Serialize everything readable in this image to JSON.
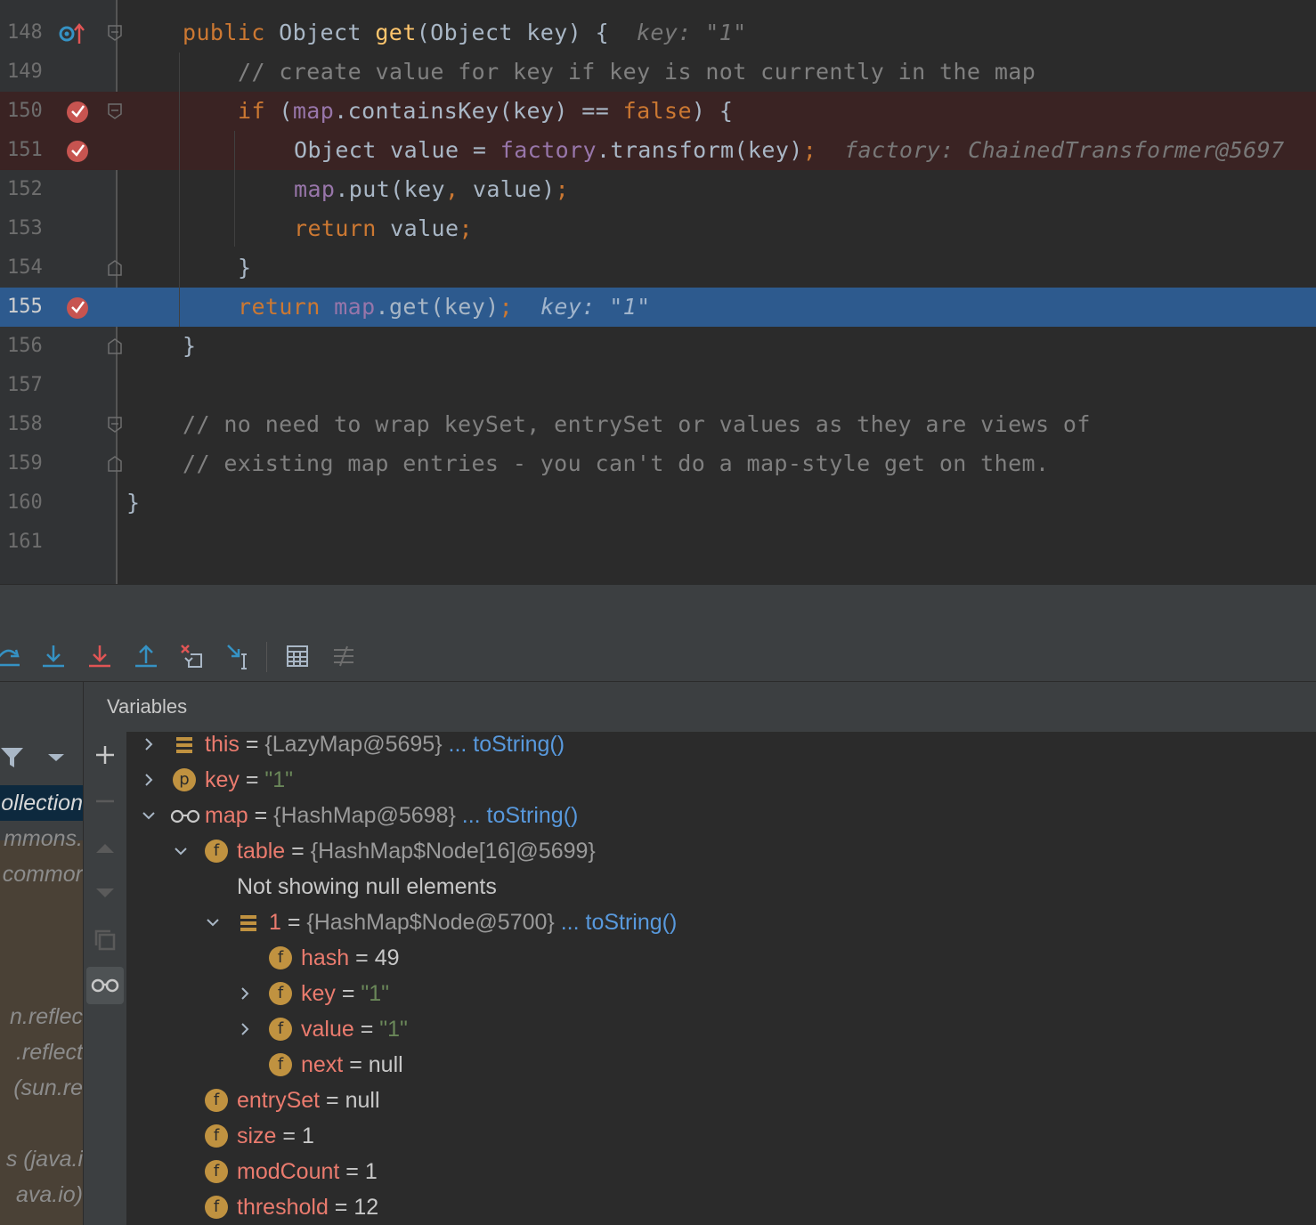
{
  "editor": {
    "lines": [
      {
        "num": "148",
        "t": [
          [
            "kw",
            "public "
          ],
          [
            "",
            "Object "
          ],
          [
            "fn",
            "get"
          ],
          [
            "",
            "(Object key) {  "
          ],
          [
            "hint",
            "key: \"1\""
          ]
        ]
      },
      {
        "num": "149",
        "t": [
          [
            "cmt",
            "// create value for key if key is not currently in the map"
          ]
        ]
      },
      {
        "num": "150",
        "t": [
          [
            "kw",
            "if "
          ],
          [
            "",
            "("
          ],
          [
            "fld",
            "map"
          ],
          [
            "",
            ".containsKey(key) == "
          ],
          [
            "kw",
            "false"
          ],
          [
            "",
            ") {"
          ]
        ]
      },
      {
        "num": "151",
        "t": [
          [
            "",
            "Object value = "
          ],
          [
            "fld",
            "factory"
          ],
          [
            "",
            ".transform(key)"
          ],
          [
            "kw",
            ";"
          ],
          [
            "",
            "  "
          ],
          [
            "hint",
            "factory: ChainedTransformer@5697"
          ]
        ]
      },
      {
        "num": "152",
        "t": [
          [
            "fld",
            "map"
          ],
          [
            "",
            ".put(key"
          ],
          [
            "kw",
            ", "
          ],
          [
            "",
            "value)"
          ],
          [
            "kw",
            ";"
          ]
        ]
      },
      {
        "num": "153",
        "t": [
          [
            "kw",
            "return "
          ],
          [
            "",
            "value"
          ],
          [
            "kw",
            ";"
          ]
        ]
      },
      {
        "num": "154",
        "t": [
          [
            "",
            "}"
          ]
        ]
      },
      {
        "num": "155",
        "t": [
          [
            "kw",
            "return "
          ],
          [
            "fld",
            "map"
          ],
          [
            "",
            ".get(key)"
          ],
          [
            "kw",
            ";"
          ],
          [
            "",
            "  "
          ],
          [
            "hint",
            "key: \"1\""
          ]
        ]
      },
      {
        "num": "156",
        "t": [
          [
            "",
            "}"
          ]
        ]
      },
      {
        "num": "157",
        "t": []
      },
      {
        "num": "158",
        "t": [
          [
            "cmt",
            "// no need to wrap keySet, entrySet or values as they are views of"
          ]
        ]
      },
      {
        "num": "159",
        "t": [
          [
            "cmt",
            "// existing map entries - you can't do a map-style get on them."
          ]
        ]
      },
      {
        "num": "160",
        "t": [
          [
            "",
            "}"
          ]
        ]
      },
      {
        "num": "161",
        "t": []
      }
    ]
  },
  "variables_panel": {
    "title": "Variables"
  },
  "frames": [
    {
      "label": "ollection",
      "sel": true
    },
    {
      "label": "mmons.",
      "sel": false
    },
    {
      "label": "commor",
      "sel": false
    },
    {
      "label": "",
      "sel": false
    },
    {
      "label": "",
      "sel": false
    },
    {
      "label": "",
      "sel": false
    },
    {
      "label": "n.reflec",
      "sel": false
    },
    {
      "label": ".reflect",
      "sel": false
    },
    {
      "label": " (sun.re",
      "sel": false
    },
    {
      "label": "",
      "sel": false
    },
    {
      "label": "s (java.i",
      "sel": false
    },
    {
      "label": "ava.io)",
      "sel": false
    }
  ],
  "variables": [
    {
      "name": "this",
      "eq": " = ",
      "value": "{LazyMap@5695}",
      "link": " ... toString()"
    },
    {
      "name": "key",
      "eq": " = ",
      "value": "\"1\""
    },
    {
      "name": "map",
      "eq": " = ",
      "value": "{HashMap@5698}",
      "link": " ... toString()"
    },
    {
      "name": "table",
      "eq": " = ",
      "value": "{HashMap$Node[16]@5699}"
    },
    {
      "note": "Not showing null elements"
    },
    {
      "name": "1",
      "eq": " = ",
      "value": "{HashMap$Node@5700}",
      "link": " ... toString()"
    },
    {
      "name": "hash",
      "eq": " = ",
      "value": "49"
    },
    {
      "name": "key",
      "eq": " = ",
      "value": "\"1\""
    },
    {
      "name": "value",
      "eq": " = ",
      "value": "\"1\""
    },
    {
      "name": "next",
      "eq": " = ",
      "value": "null"
    },
    {
      "name": "entrySet",
      "eq": " = ",
      "value": "null"
    },
    {
      "name": "size",
      "eq": " = ",
      "value": "1"
    },
    {
      "name": "modCount",
      "eq": " = ",
      "value": "1"
    },
    {
      "name": "threshold",
      "eq": " = ",
      "value": "12"
    }
  ],
  "icons": {
    "breakpoint_color": "#c75450",
    "field_icon_letter": "f",
    "param_icon_letter": "p",
    "accent": "#3592c4"
  }
}
